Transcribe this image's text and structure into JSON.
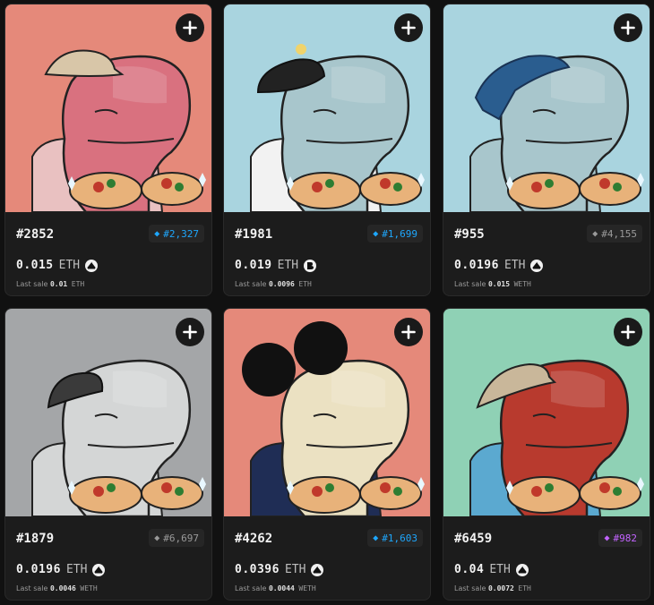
{
  "cards": [
    {
      "token": "#2852",
      "rank": {
        "label": "#2,327",
        "color": "#1ea7fd",
        "icon": "diamond"
      },
      "price": "0.015",
      "unit": "ETH",
      "marketplace": "opensea-icon",
      "last_sale_label": "Last sale",
      "last_sale_value": "0.01",
      "last_sale_unit": "ETH",
      "bg": "#e5897a",
      "body": "#d9717f",
      "hat": "#d8c6a8",
      "shirt": "#e9c1c1"
    },
    {
      "token": "#1981",
      "rank": {
        "label": "#1,699",
        "color": "#1ea7fd",
        "icon": "diamond"
      },
      "price": "0.019",
      "unit": "ETH",
      "marketplace": "blur-icon",
      "last_sale_label": "Last sale",
      "last_sale_value": "0.0096",
      "last_sale_unit": "ETH",
      "bg": "#a9d4df",
      "body": "#a8c6cc",
      "hat": "#222222",
      "shirt": "#f2f2f2"
    },
    {
      "token": "#955",
      "rank": {
        "label": "#4,155",
        "color": "#9a9a9a",
        "icon": "diamond"
      },
      "price": "0.0196",
      "unit": "ETH",
      "marketplace": "opensea-icon",
      "last_sale_label": "Last sale",
      "last_sale_value": "0.015",
      "last_sale_unit": "WETH",
      "bg": "#a9d4df",
      "body": "#a8c6cc",
      "hat": "#2a5d8f",
      "shirt": "#a8c6cc"
    },
    {
      "token": "#1879",
      "rank": {
        "label": "#6,697",
        "color": "#9a9a9a",
        "icon": "diamond"
      },
      "price": "0.0196",
      "unit": "ETH",
      "marketplace": "opensea-icon",
      "last_sale_label": "Last sale",
      "last_sale_value": "0.0046",
      "last_sale_unit": "WETH",
      "bg": "#a4a6a8",
      "body": "#d4d6d6",
      "hat": "#3a3a3a",
      "shirt": "#d4d6d6"
    },
    {
      "token": "#4262",
      "rank": {
        "label": "#1,603",
        "color": "#1ea7fd",
        "icon": "diamond"
      },
      "price": "0.0396",
      "unit": "ETH",
      "marketplace": "opensea-icon",
      "last_sale_label": "Last sale",
      "last_sale_value": "0.0044",
      "last_sale_unit": "WETH",
      "bg": "#e5897a",
      "body": "#ebe1c2",
      "hat": "#111111",
      "shirt": "#1f2d55"
    },
    {
      "token": "#6459",
      "rank": {
        "label": "#982",
        "color": "#c264ff",
        "icon": "diamond"
      },
      "price": "0.04",
      "unit": "ETH",
      "marketplace": "opensea-icon",
      "last_sale_label": "Last sale",
      "last_sale_value": "0.0072",
      "last_sale_unit": "ETH",
      "bg": "#8fd1b5",
      "body": "#b83a2e",
      "hat": "#c9b79a",
      "shirt": "#5ba9d0"
    }
  ]
}
